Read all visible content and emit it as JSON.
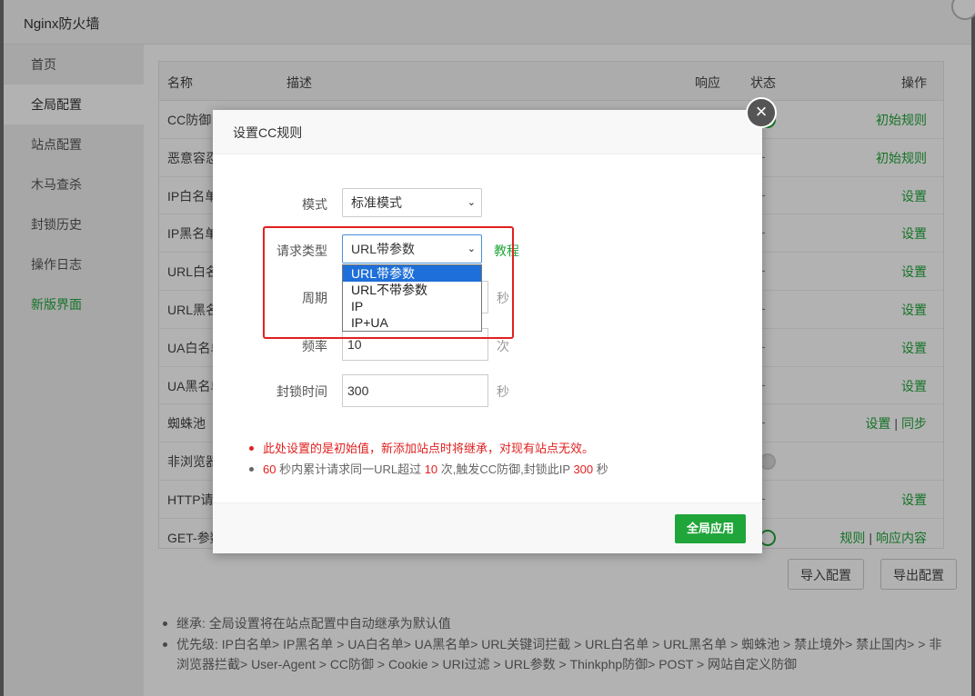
{
  "window": {
    "title": "Nginx防火墙"
  },
  "sidebar": {
    "items": [
      "首页",
      "全局配置",
      "站点配置",
      "木马查杀",
      "封锁历史",
      "操作日志",
      "新版界面"
    ]
  },
  "table": {
    "headers": {
      "name": "名称",
      "desc": "描述",
      "response": "响应",
      "status": "状态",
      "op": "操作"
    },
    "rows": [
      {
        "name": "CC防御",
        "op1": "初始规则"
      },
      {
        "name": "恶意容忍",
        "op1": "初始规则"
      },
      {
        "name": "IP白名单",
        "op1": "设置"
      },
      {
        "name": "IP黑名单",
        "op1": "设置"
      },
      {
        "name": "URL白名单",
        "op1": "设置"
      },
      {
        "name": "URL黑名单",
        "op1": "设置"
      },
      {
        "name": "UA白名单",
        "op1": "设置"
      },
      {
        "name": "UA黑名单",
        "op1": "设置"
      },
      {
        "name": "蜘蛛池",
        "op1": "设置",
        "op2": "同步"
      },
      {
        "name": "非浏览器",
        "op1": ""
      },
      {
        "name": "HTTP请求",
        "op1": "设置"
      },
      {
        "name": "GET-参数",
        "op1": "规则",
        "op2": "响应内容"
      }
    ],
    "dash": "-"
  },
  "buttons": {
    "import": "导入配置",
    "export": "导出配置"
  },
  "notes": {
    "inherit": "继承: 全局设置将在站点配置中自动继承为默认值",
    "priority": "优先级: IP白名单> IP黑名单 > UA白名单> UA黑名单> URL关键词拦截 > URL白名单 > URL黑名单 > 蜘蛛池 > 禁止境外> 禁止国内> > 非浏览器拦截> User-Agent > CC防御 > Cookie > URI过滤 > URL参数 > Thinkphp防御> POST > 网站自定义防御"
  },
  "modal": {
    "title": "设置CC规则",
    "close": "×",
    "mode": {
      "label": "模式",
      "value": "标准模式"
    },
    "request_type": {
      "label": "请求类型",
      "value": "URL带参数",
      "options": [
        "URL带参数",
        "URL不带参数",
        "IP",
        "IP+UA"
      ],
      "selected_index": 0
    },
    "tutorial": "教程",
    "period": {
      "label": "周期",
      "unit": "秒"
    },
    "frequency": {
      "label": "频率",
      "value": "10",
      "unit": "次"
    },
    "block_time": {
      "label": "封锁时间",
      "value": "300",
      "unit": "秒"
    },
    "warning": "此处设置的是初始值，新添加站点时将继承，对现有站点无效。",
    "summary": {
      "period": "60",
      "t1": " 秒内累计请求同一URL超过 ",
      "freq": "10",
      "t2": " 次,触发CC防御,封锁此IP ",
      "block": "300",
      "t3": " 秒"
    },
    "apply": "全局应用"
  },
  "colors": {
    "accent": "#20a53a",
    "warning": "#e02020",
    "selection": "#1e6fd9"
  }
}
